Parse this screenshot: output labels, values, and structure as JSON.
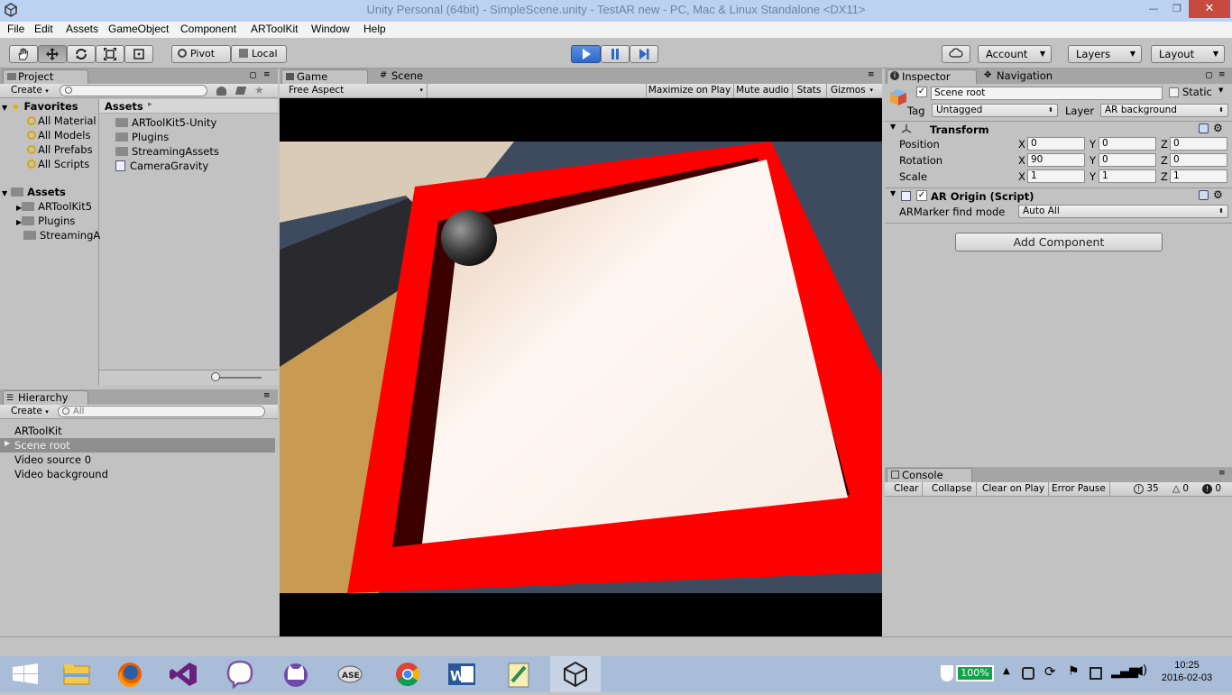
{
  "window": {
    "title": "Unity Personal (64bit) - SimpleScene.unity - TestAR new - PC, Mac & Linux Standalone <DX11>",
    "minimize_glyph": "—",
    "maximize_glyph": "❐",
    "close_glyph": "✕"
  },
  "menu": [
    "File",
    "Edit",
    "Assets",
    "GameObject",
    "Component",
    "ARToolKit",
    "Window",
    "Help"
  ],
  "toolbar": {
    "pivot_label": "Pivot",
    "local_label": "Local",
    "account_label": "Account",
    "layers_label": "Layers",
    "layout_label": "Layout"
  },
  "project": {
    "tab_label": "Project",
    "create_label": "Create",
    "favorites_label": "Favorites",
    "favorites": [
      "All Material",
      "All Models",
      "All Prefabs",
      "All Scripts"
    ],
    "assets_label": "Assets",
    "asset_tree": [
      "ARToolKit5",
      "Plugins",
      "StreamingA"
    ],
    "breadcrumb": "Assets",
    "breadcrumb_arrow": "▸",
    "asset_items": [
      "ARToolKit5-Unity",
      "Plugins",
      "StreamingAssets",
      "CameraGravity"
    ]
  },
  "hierarchy": {
    "tab_label": "Hierarchy",
    "create_label": "Create",
    "search_placeholder": "All",
    "items": [
      "ARToolKit",
      "Scene root",
      "Video source 0",
      "Video background"
    ]
  },
  "game": {
    "tab_label": "Game",
    "scene_tab_label": "Scene",
    "aspect_label": "Free Aspect",
    "maximize_label": "Maximize on Play",
    "mute_label": "Mute audio",
    "stats_label": "Stats",
    "gizmos_label": "Gizmos"
  },
  "inspector": {
    "tab_label": "Inspector",
    "nav_tab_label": "Navigation",
    "object_name": "Scene root",
    "static_label": "Static",
    "tag_label": "Tag",
    "tag_value": "Untagged",
    "layer_label": "Layer",
    "layer_value": "AR background",
    "transform_label": "Transform",
    "position_label": "Position",
    "rotation_label": "Rotation",
    "scale_label": "Scale",
    "axis_x": "X",
    "axis_y": "Y",
    "axis_z": "Z",
    "position": {
      "x": "0",
      "y": "0",
      "z": "0"
    },
    "rotation": {
      "x": "90",
      "y": "0",
      "z": "0"
    },
    "scale": {
      "x": "1",
      "y": "1",
      "z": "1"
    },
    "script_label": "AR Origin (Script)",
    "marker_mode_label": "ARMarker find mode",
    "marker_mode_value": "Auto All",
    "add_component_label": "Add Component"
  },
  "console": {
    "tab_label": "Console",
    "clear_label": "Clear",
    "collapse_label": "Collapse",
    "clear_on_play_label": "Clear on Play",
    "error_pause_label": "Error Pause",
    "log_count": "35",
    "warn_count": "0",
    "error_count": "0"
  },
  "taskbar": {
    "battery": "100%",
    "time": "10:25",
    "date": "2016-02-03"
  },
  "colors": {
    "accent_blue": "#3b78d8",
    "board_red": "#ff0000",
    "panel_grey": "#c2c2c2"
  }
}
